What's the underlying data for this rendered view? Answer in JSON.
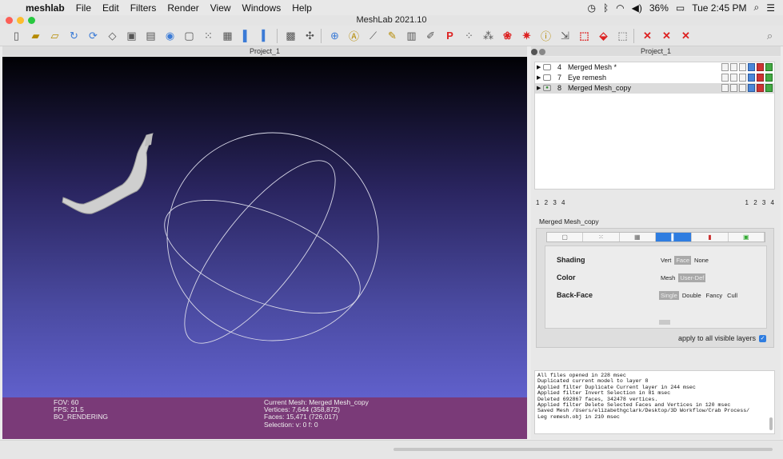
{
  "menubar": {
    "app_name": "meshlab",
    "items": [
      "File",
      "Edit",
      "Filters",
      "Render",
      "View",
      "Windows",
      "Help"
    ],
    "battery": "36%",
    "clock": "Tue 2:45 PM"
  },
  "window": {
    "title": "MeshLab 2021.10"
  },
  "viewport_tab": {
    "title": "Project_1"
  },
  "panel_tab": {
    "title": "Project_1"
  },
  "viewport_info": {
    "fov": "FOV: 60",
    "fps": "FPS:   21.5",
    "mode": "BO_RENDERING",
    "current_mesh": "Current Mesh: Merged Mesh_copy",
    "vertices": "Vertices: 7,644    (358,872)",
    "faces": "Faces: 15,471    (726,017)",
    "selection": "Selection: v: 0 f: 0"
  },
  "layers": [
    {
      "num": "4",
      "name": "Merged Mesh *"
    },
    {
      "num": "7",
      "name": "Eye remesh"
    },
    {
      "num": "8",
      "name": "Merged Mesh_copy"
    }
  ],
  "pages_left": "1 2 3 4",
  "pages_right": "1 2 3 4",
  "selected_layer": "Merged Mesh_copy",
  "render_props": {
    "shading": {
      "label": "Shading",
      "options": [
        "Vert",
        "Face",
        "None"
      ],
      "selected": "Face"
    },
    "color": {
      "label": "Color",
      "options": [
        "Mesh",
        "User-Def"
      ],
      "selected": "User-Def"
    },
    "backface": {
      "label": "Back-Face",
      "options": [
        "Single",
        "Double",
        "Fancy",
        "Cull"
      ],
      "selected": "Single"
    },
    "apply_all": "apply to all visible layers"
  },
  "log_lines": [
    "All files opened in 228 msec",
    "Duplicated current model to layer 8",
    "Applied filter Duplicate Current layer in 244 msec",
    "Applied filter Invert Selection in 81 msec",
    "Deleted 692867 faces, 342478 vertices.",
    "Applied filter Delete Selected Faces and Vertices in 120 msec",
    "Saved Mesh /Users/elizabethgclark/Desktop/3D Workflow/Crab Process/",
    "Leg remesh.obj in 210 msec"
  ],
  "colors": {
    "info_bar": "#7a3a78",
    "accent": "#2f7de0",
    "viewport_top": "#010104",
    "viewport_bottom": "#6a6adf"
  }
}
